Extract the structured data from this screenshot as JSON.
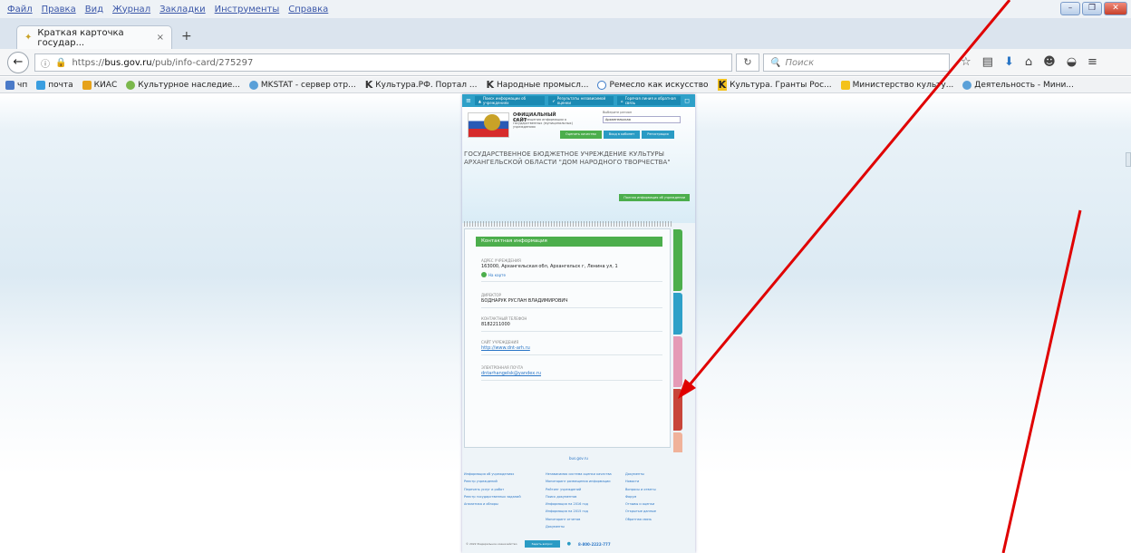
{
  "menu": [
    "Файл",
    "Правка",
    "Вид",
    "Журнал",
    "Закладки",
    "Инструменты",
    "Справка"
  ],
  "window_controls": {
    "minimize": "–",
    "restore": "❐",
    "close": "✕"
  },
  "tab": {
    "title": "Краткая карточка государ...",
    "close": "×",
    "new_tab": "+"
  },
  "url": {
    "prefix": "https://",
    "host": "bus.gov.ru",
    "path": "/pub/info-card/275297"
  },
  "search": {
    "placeholder": "Поиск"
  },
  "bookmarks": [
    "чп",
    "почта",
    "КИАС",
    "Культурное наследие...",
    "MKSTAT - сервер отр...",
    "Культура.РФ. Портал ...",
    "Народные промысл...",
    "Ремесло как искусство",
    "Культура. Гранты Рос...",
    "Министерство культу...",
    "Деятельность - Мини..."
  ],
  "site": {
    "nav": [
      "Поиск информации об учреждениях",
      "Результаты независимой оценки",
      "Горячая линия и обратная связь"
    ],
    "official_title": "ОФИЦИАЛЬНЫЙ САЙТ",
    "official_sub": "для размещения информации о государственных (муниципальных) учреждениях",
    "region_label": "Выберите регион",
    "region_value": "Архангельская",
    "buttons": [
      "Оценить качество",
      "Вход в кабинет",
      "Регистрация"
    ],
    "org_name": "ГОСУДАРСТВЕННОЕ БЮДЖЕТНОЕ УЧРЕЖДЕНИЕ КУЛЬТУРЫ АРХАНГЕЛЬСКОЙ ОБЛАСТИ \"ДОМ НАРОДНОГО ТВОРЧЕСТВА\"",
    "green_button": "Полная информация об учреждении",
    "card_header": "Контактная информация",
    "address_label": "АДРЕС УЧРЕЖДЕНИЯ",
    "address": "163000, Архангельская обл, Архангельск г, Ленина ул, 1",
    "map_link": "На карте",
    "director_label": "ДИРЕКТОР",
    "director": "БОДНАРУК РУСЛАН ВЛАДИМИРОВИЧ",
    "phone_label": "КОНТАКТНЫЙ ТЕЛЕФОН",
    "phone": "8182211000",
    "site_label": "САЙТ УЧРЕЖДЕНИЯ",
    "site_link": "http://www.dnt-arh.ru",
    "email_label": "ЭЛЕКТРОННАЯ ПОЧТА",
    "email": "dntarhangelsk@yandex.ru",
    "footer_logo": "bus.gov.ru",
    "footer_col1": [
      "Информация об учреждениях",
      "Реестр учреждений",
      "Перечень услуг и работ",
      "Реестр государственных заданий",
      "Аналитика и обзоры"
    ],
    "footer_col2": [
      "Независимая система оценки качества",
      "Мониторинг размещения информации",
      "Рейтинг учреждений",
      "Поиск документов",
      "Информация на 2016 год",
      "Информация на 2015 год",
      "Мониторинг отчетов",
      "Документы"
    ],
    "footer_col3": [
      "Документы",
      "Новости",
      "Вопросы и ответы",
      "Форум",
      "Отзывы и оценки",
      "Открытые данные",
      "Обратная связь"
    ],
    "footer_copy": "© 2022 Федеральное казначейство",
    "footer_btn": "Задать вопрос",
    "footer_phone": "8-800-2222-777"
  },
  "colors": {
    "arrow": "#e00000",
    "accent_green": "#4cae4c",
    "site_blue": "#2ea0c8"
  }
}
